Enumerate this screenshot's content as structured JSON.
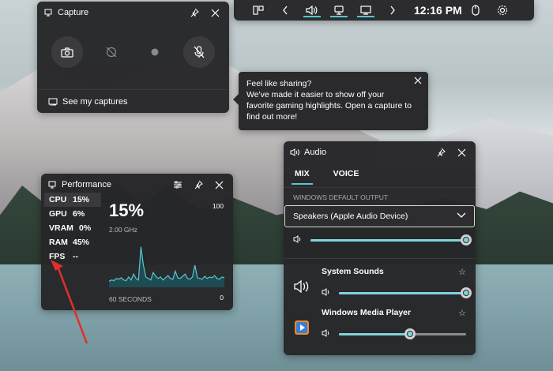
{
  "topbar": {
    "clock": "12:16 PM",
    "items": [
      "widget-menu-icon",
      "chevron-left-icon",
      "audio-icon",
      "capture-icon",
      "performance-icon",
      "chevron-right-icon",
      "mouse-icon",
      "gear-icon"
    ]
  },
  "capture": {
    "title": "Capture",
    "footer_link": "See my captures"
  },
  "tooltip": {
    "title": "Feel like sharing?",
    "body": "We've made it easier to show off your favorite gaming highlights. Open a capture to find out more!"
  },
  "performance": {
    "title": "Performance",
    "metrics": [
      {
        "label": "CPU",
        "value": "15%"
      },
      {
        "label": "GPU",
        "value": "6%"
      },
      {
        "label": "VRAM",
        "value": "0%"
      },
      {
        "label": "RAM",
        "value": "45%"
      },
      {
        "label": "FPS",
        "value": "--"
      }
    ],
    "big_value": "15%",
    "sub_value": "2.00 GHz",
    "max_label": "100",
    "min_label": "0",
    "time_label": "60 SECONDS",
    "cpu_history": [
      8,
      10,
      9,
      12,
      11,
      13,
      10,
      9,
      14,
      10,
      18,
      12,
      10,
      55,
      30,
      14,
      12,
      10,
      20,
      15,
      12,
      14,
      10,
      13,
      16,
      12,
      11,
      22,
      13,
      12,
      15,
      18,
      12,
      11,
      14,
      30,
      13,
      12,
      11,
      15,
      12,
      14,
      13,
      16,
      12,
      11,
      14,
      13
    ]
  },
  "audio": {
    "title": "Audio",
    "tabs": [
      "MIX",
      "VOICE"
    ],
    "section_label": "WINDOWS DEFAULT OUTPUT",
    "device": "Speakers (Apple Audio Device)",
    "master_volume": 1.0,
    "apps": [
      {
        "name": "System Sounds",
        "volume": 1.0,
        "icon": "speaker-icon"
      },
      {
        "name": "Windows Media Player",
        "volume": 0.56,
        "icon": "media-player-icon"
      }
    ]
  },
  "colors": {
    "accent": "#56c7d1",
    "panel": "#262628"
  }
}
